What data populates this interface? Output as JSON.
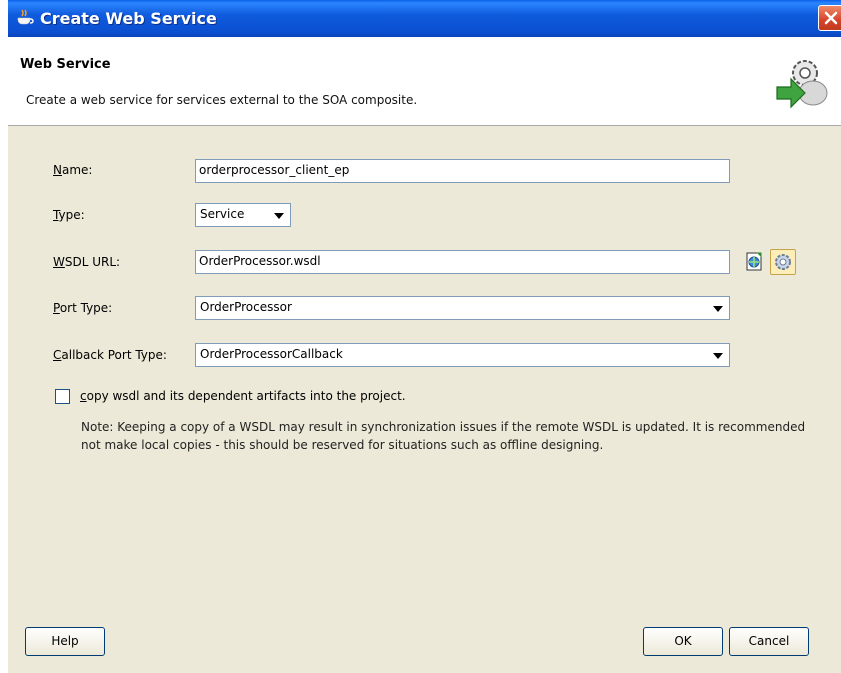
{
  "window": {
    "title": "Create Web Service"
  },
  "header": {
    "title": "Web Service",
    "subtitle": "Create a web service for services external to the SOA composite."
  },
  "form": {
    "name_label_key": "N",
    "name_label_rest": "ame:",
    "name_value": "orderprocessor_client_ep",
    "type_label_key": "T",
    "type_label_rest": "ype:",
    "type_value": "Service",
    "wsdl_label_key": "W",
    "wsdl_label_rest": "SDL URL:",
    "wsdl_value": "OrderProcessor.wsdl",
    "port_label_key": "P",
    "port_label_rest": "ort Type:",
    "port_value": "OrderProcessor",
    "callback_label_key": "C",
    "callback_label_rest": "allback Port Type:",
    "callback_value": "OrderProcessorCallback"
  },
  "copy_option": {
    "label_key": "c",
    "label_rest": "opy wsdl and its dependent artifacts into the project.",
    "checked": false
  },
  "note": "Note: Keeping a copy of a WSDL may result in synchronization issues if the remote WSDL is updated. It is recommended not make local copies - this should be reserved for situations such as offline designing.",
  "buttons": {
    "help": "Help",
    "ok": "OK",
    "cancel": "Cancel"
  },
  "icons": {
    "title": "jdev-cup-icon",
    "header": "web-service-gear-icon",
    "browse_wsdl": "browse-wsdl-icon",
    "find_service": "find-service-gear-icon",
    "close": "close-icon"
  }
}
